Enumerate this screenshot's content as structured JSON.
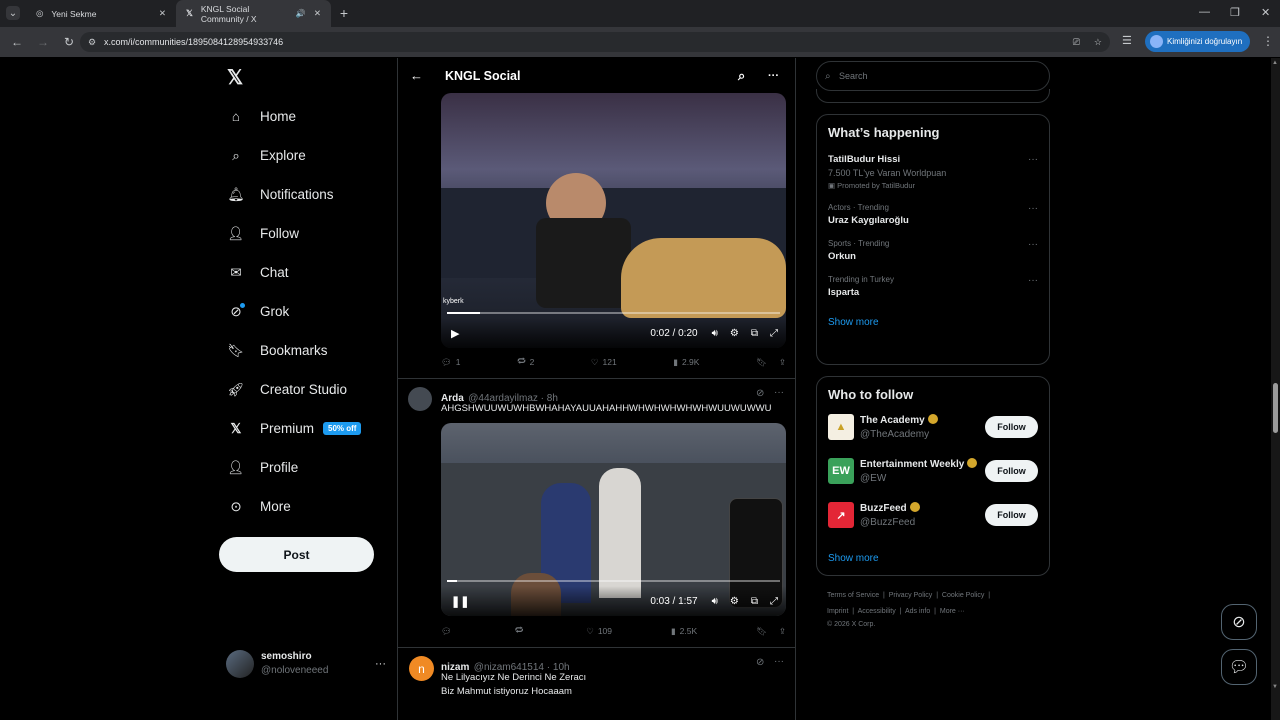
{
  "browser": {
    "tabs": [
      {
        "title": "Yeni Sekme"
      },
      {
        "title": "KNGL Social Community / X"
      }
    ],
    "url": "x.com/i/communities/1895084128954933746",
    "profile_pill": "Kimliğinizi doğrulayın"
  },
  "nav": {
    "items": [
      "Home",
      "Explore",
      "Notifications",
      "Follow",
      "Chat",
      "Grok",
      "Bookmarks",
      "Creator Studio",
      "Premium",
      "Profile",
      "More"
    ],
    "premium_badge": "50% off",
    "post_button": "Post"
  },
  "account": {
    "name": "semoshiro",
    "handle": "@noloveneeed"
  },
  "header": {
    "title": "KNGL Social"
  },
  "tweet1": {
    "watermark": "kyberk",
    "time": "0:02 / 0:20",
    "progress": 0.1,
    "stats": {
      "replies": "1",
      "reposts": "2",
      "likes": "121",
      "views": "2.9K"
    }
  },
  "tweet2": {
    "name": "Arda",
    "handle": "@44ardayilmaz · 8h",
    "text": "AHGSHWUUWUWHBWHAHAYAUUAHAHHWHWHWHWHWHWUUWUWWU",
    "time": "0:03 / 1:57",
    "progress": 0.03,
    "stats": {
      "replies": "",
      "reposts": "",
      "likes": "109",
      "views": "2.5K"
    }
  },
  "tweet3": {
    "name": "nizam",
    "handle": "@nizam641514 · 10h",
    "line1": "Ne Lilyacıyız Ne Derinci Ne Zeracı",
    "line2": "Biz Mahmut istiyoruz Hocaaam",
    "avatar_letter": "n"
  },
  "right": {
    "search_placeholder": "Search",
    "happening_title": "What’s happening",
    "trends": [
      {
        "meta": "",
        "title": "TatilBudur Hissi",
        "sub": "7.500 TL'ye Varan Worldpuan",
        "promo": "Promoted by TatilBudur"
      },
      {
        "meta": "Actors · Trending",
        "title": "Uraz Kaygılaroğlu"
      },
      {
        "meta": "Sports · Trending",
        "title": "Orkun"
      },
      {
        "meta": "Trending in Turkey",
        "title": "Isparta"
      }
    ],
    "show_more": "Show more",
    "wtf_title": "Who to follow",
    "follow_label": "Follow",
    "accounts": [
      {
        "name": "The Academy",
        "handle": "@TheAcademy",
        "mark": "▲",
        "bg": "#f4efe2",
        "fg": "#c9a227"
      },
      {
        "name": "Entertainment Weekly",
        "handle": "@EW",
        "mark": "EW",
        "bg": "#3aa15a",
        "fg": "#ffffff"
      },
      {
        "name": "BuzzFeed",
        "handle": "@BuzzFeed",
        "mark": "↗",
        "bg": "#e32636",
        "fg": "#ffffff"
      }
    ],
    "footer": {
      "row1": [
        "Terms of Service",
        "Privacy Policy",
        "Cookie Policy"
      ],
      "row2": [
        "Imprint",
        "Accessibility",
        "Ads info",
        "More ···"
      ],
      "copyright": "© 2026 X Corp."
    }
  },
  "colors": {
    "accent": "#1d9bf0",
    "bg": "#000000",
    "border": "#2f3336"
  }
}
